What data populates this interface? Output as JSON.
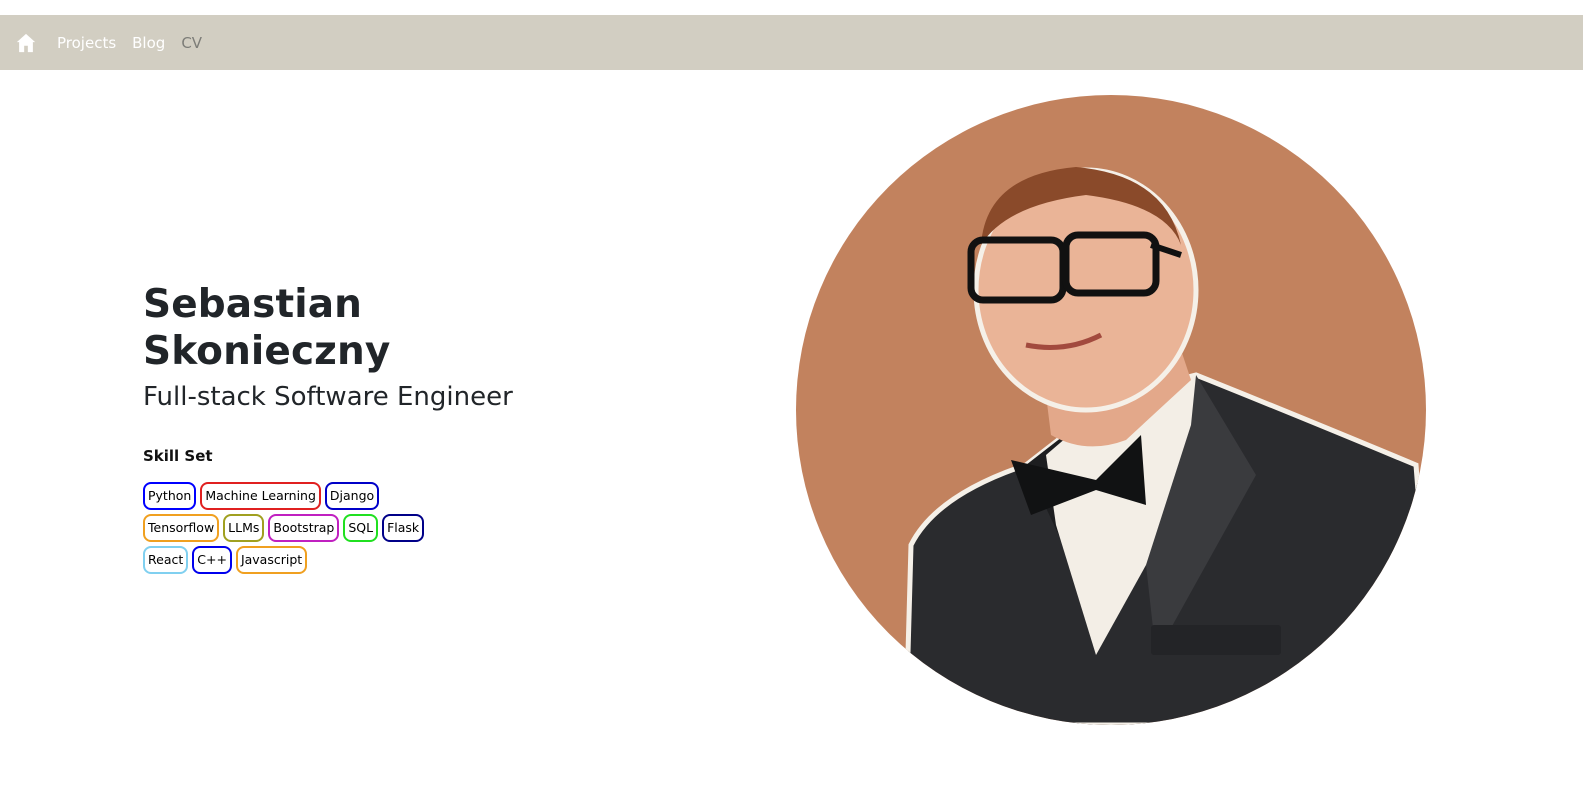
{
  "nav": {
    "home_icon": "home-icon",
    "links": [
      {
        "label": "Projects"
      },
      {
        "label": "Blog"
      },
      {
        "label": "CV"
      }
    ]
  },
  "profile": {
    "name": "Sebastian Skonieczny",
    "title": "Full-stack Software Engineer"
  },
  "skills": {
    "heading": "Skill Set",
    "items": [
      {
        "label": "Python",
        "color": "#0000ff"
      },
      {
        "label": "Machine Learning",
        "color": "#e02020"
      },
      {
        "label": "Django",
        "color": "#0000c8"
      },
      {
        "label": "Tensorflow",
        "color": "#f0a020"
      },
      {
        "label": "LLMs",
        "color": "#a0a020"
      },
      {
        "label": "Bootstrap",
        "color": "#c020c0"
      },
      {
        "label": "SQL",
        "color": "#20e020"
      },
      {
        "label": "Flask",
        "color": "#000088"
      },
      {
        "label": "React",
        "color": "#80d0f0"
      },
      {
        "label": "C++",
        "color": "#0000ee"
      },
      {
        "label": "Javascript",
        "color": "#f0a020"
      }
    ]
  },
  "colors": {
    "navbar_bg": "#d2cec2",
    "portrait_bg": "#c2825e"
  }
}
